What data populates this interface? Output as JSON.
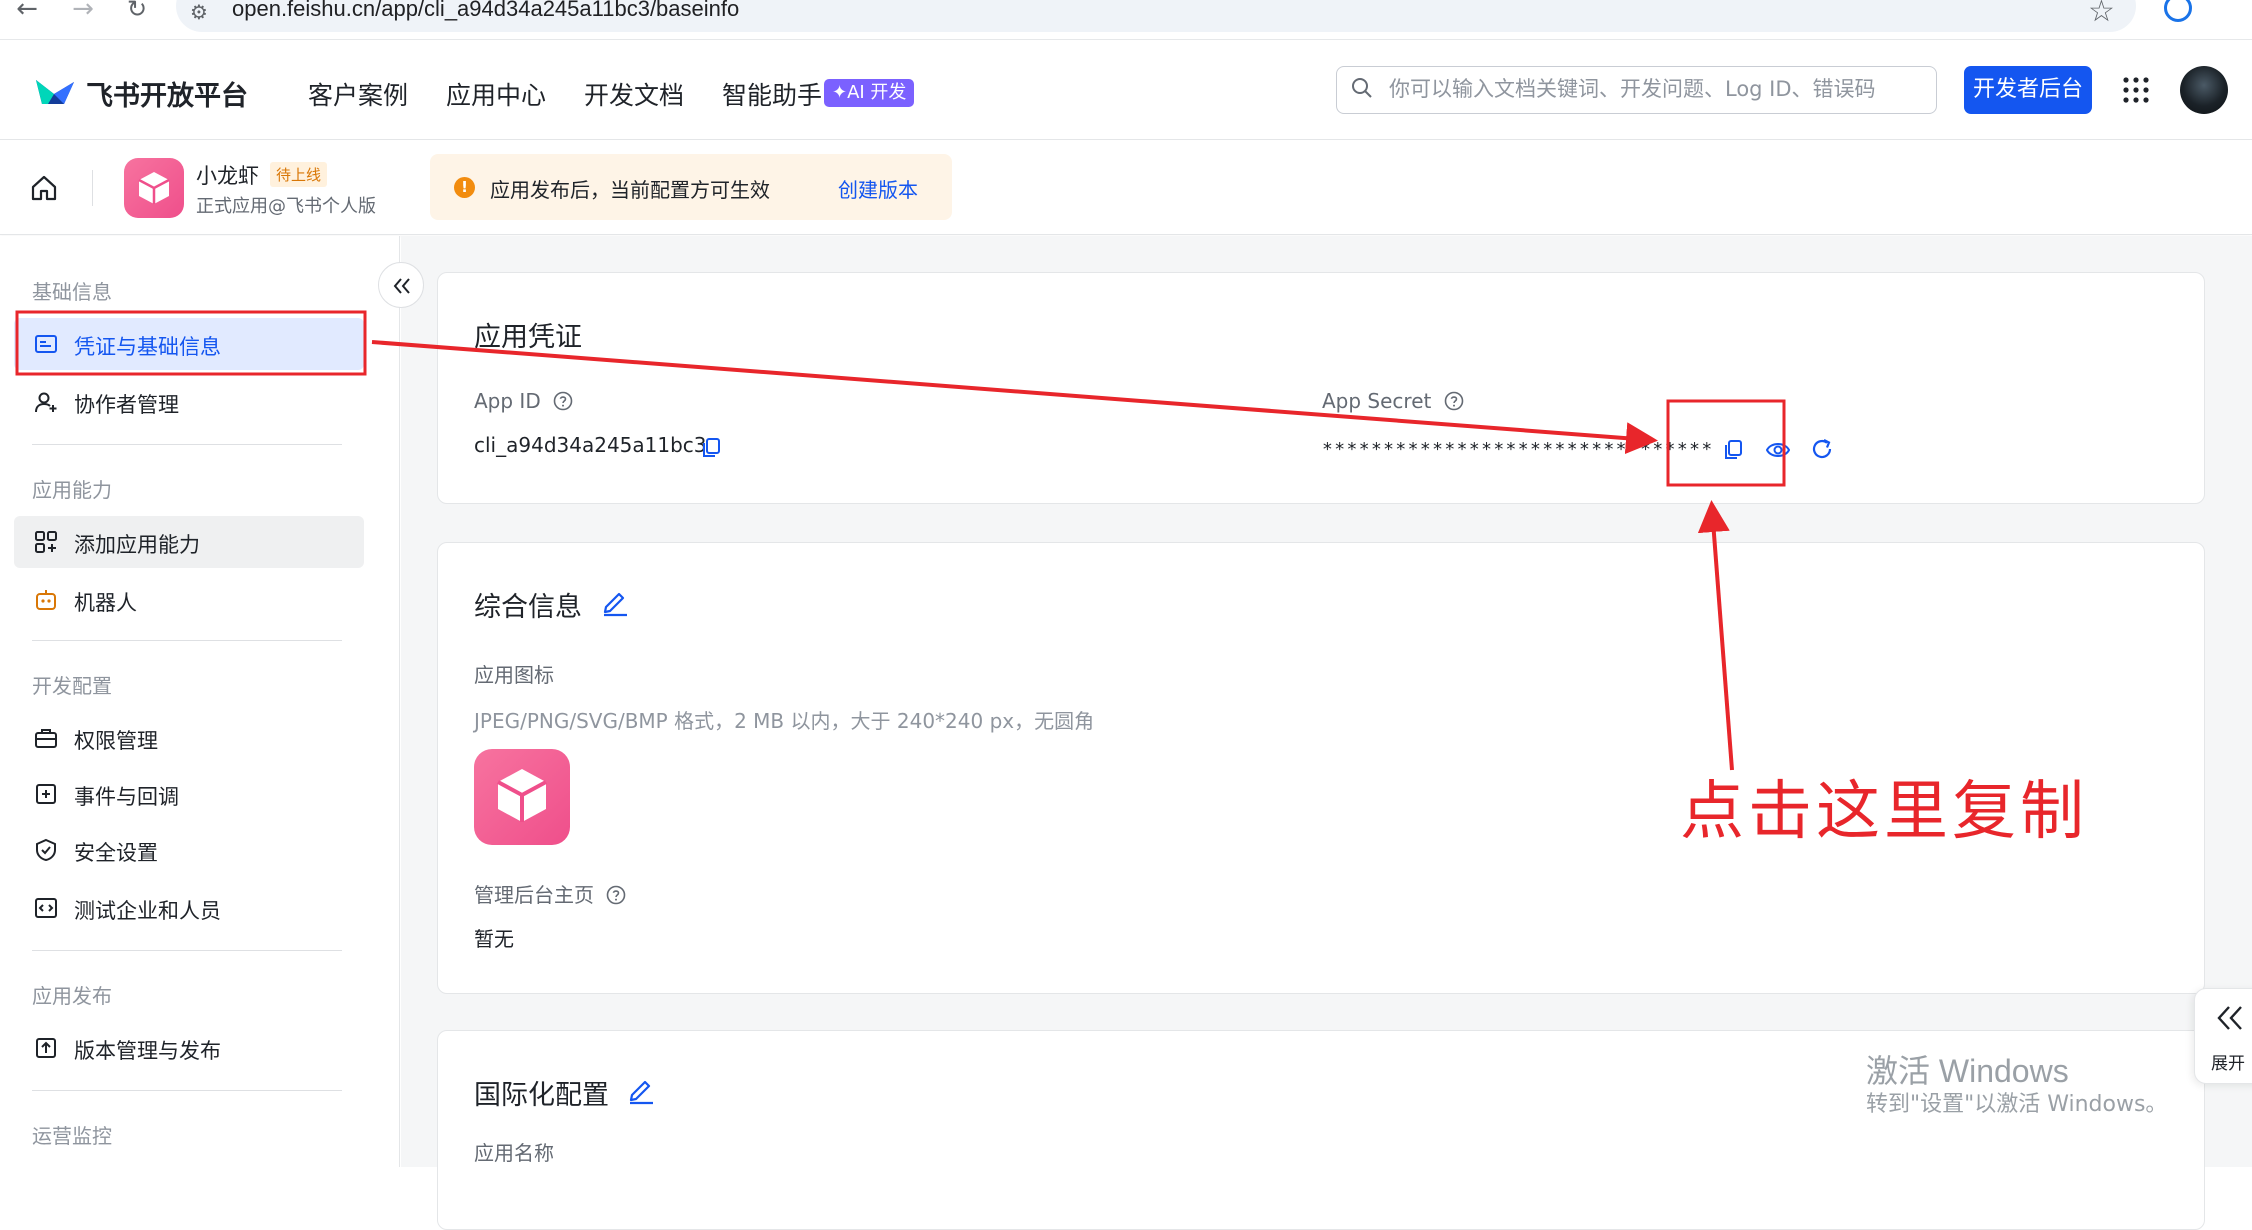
{
  "browser": {
    "url": "open.feishu.cn/app/cli_a94d34a245a11bc3/baseinfo"
  },
  "topnav": {
    "brand": "飞书开放平台",
    "links": [
      "客户案例",
      "应用中心",
      "开发文档",
      "智能助手"
    ],
    "ai_badge": "✦AI 开发",
    "search_placeholder": "你可以输入文档关键词、开发问题、Log ID、错误码",
    "dev_console": "开发者后台"
  },
  "app": {
    "name": "小龙虾",
    "status": "待上线",
    "subtitle": "正式应用@飞书个人版",
    "notice_text": "应用发布后，当前配置方可生效",
    "notice_link": "创建版本",
    "notice_icon": "!"
  },
  "sidebar": {
    "sections": [
      {
        "title": "基础信息",
        "items": [
          {
            "label": "凭证与基础信息",
            "icon": "id-card-icon",
            "active": true
          },
          {
            "label": "协作者管理",
            "icon": "user-add-icon"
          }
        ]
      },
      {
        "title": "应用能力",
        "items": [
          {
            "label": "添加应用能力",
            "icon": "grid-plus-icon"
          },
          {
            "label": "机器人",
            "icon": "robot-icon"
          }
        ]
      },
      {
        "title": "开发配置",
        "items": [
          {
            "label": "权限管理",
            "icon": "briefcase-icon"
          },
          {
            "label": "事件与回调",
            "icon": "event-icon"
          },
          {
            "label": "安全设置",
            "icon": "shield-icon"
          },
          {
            "label": "测试企业和人员",
            "icon": "code-icon"
          }
        ]
      },
      {
        "title": "应用发布",
        "items": [
          {
            "label": "版本管理与发布",
            "icon": "upload-icon"
          }
        ]
      },
      {
        "title": "运营监控",
        "items": []
      }
    ]
  },
  "credentials": {
    "title": "应用凭证",
    "app_id_label": "App ID",
    "app_id_value": "cli_a94d34a245a11bc3",
    "secret_label": "App Secret",
    "secret_value": "********************************"
  },
  "general": {
    "title": "综合信息",
    "icon_label": "应用图标",
    "icon_hint": "JPEG/PNG/SVG/BMP 格式，2 MB 以内，大于 240*240 px，无圆角",
    "admin_label": "管理后台主页",
    "admin_value": "暂无"
  },
  "i18n": {
    "title": "国际化配置",
    "name_label": "应用名称"
  },
  "annotation": {
    "text": "点击这里复制",
    "color": "#e8262b"
  },
  "watermark": {
    "line1": "激活 Windows",
    "line2": "转到\"设置\"以激活 Windows。"
  },
  "expand_panel": {
    "label": "展开"
  },
  "colors": {
    "accent": "#1456f0",
    "active_bg": "#e1eaff",
    "app_icon": "#ef4f8b"
  }
}
